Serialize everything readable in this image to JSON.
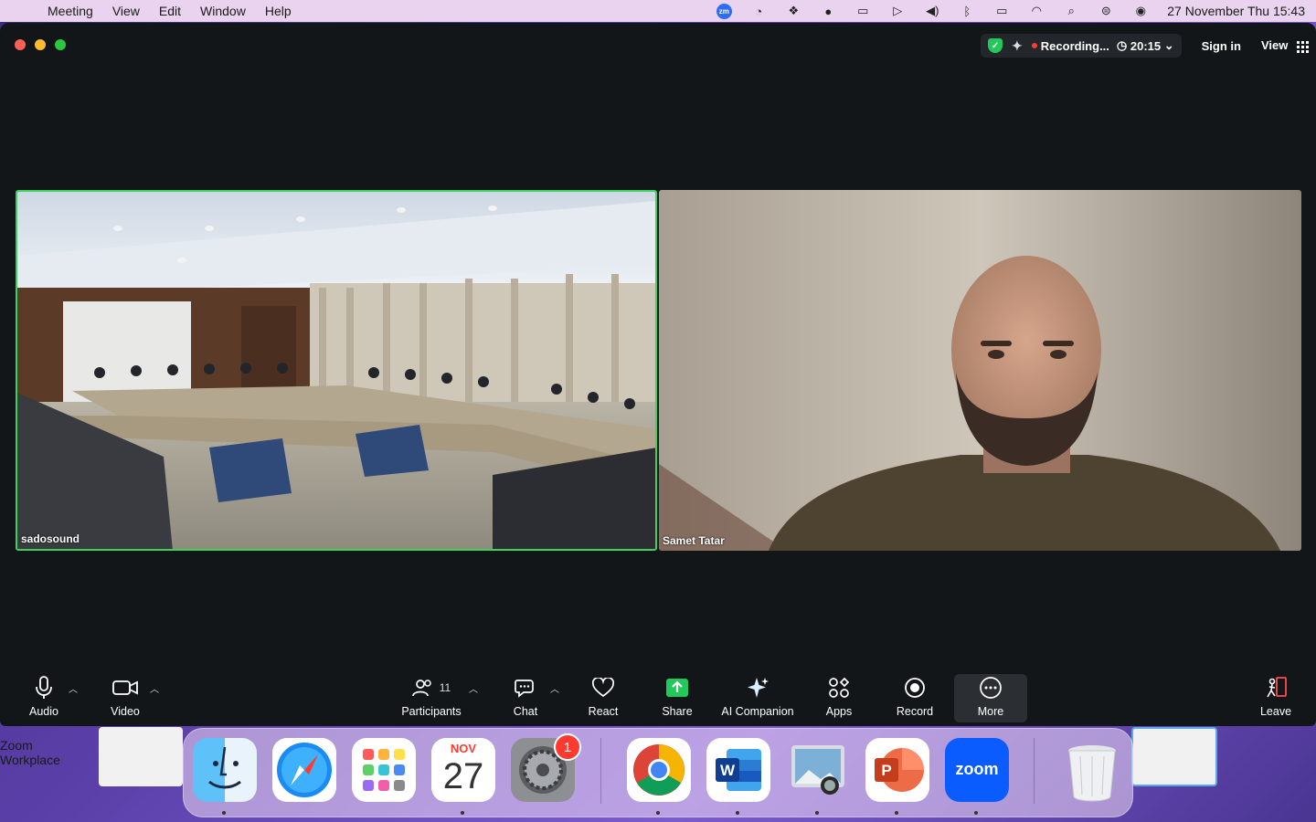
{
  "menubar": {
    "app_name": "Zoom Workplace",
    "items": [
      "Meeting",
      "View",
      "Edit",
      "Window",
      "Help"
    ],
    "status_icons": [
      "zoom-status-icon",
      "screen-time-icon",
      "dropbox-icon",
      "grammarly-icon",
      "screen-record-icon",
      "play-icon",
      "volume-icon",
      "bluetooth-icon",
      "battery-icon",
      "wifi-icon",
      "spotlight-icon",
      "control-center-icon",
      "siri-icon"
    ],
    "zoom_badge": "zm",
    "clock": "27 November Thu  15:43"
  },
  "window": {
    "recording_label": "Recording...",
    "timer": "20:15",
    "sign_in": "Sign in",
    "view": "View"
  },
  "tiles": [
    {
      "name": "sadosound",
      "active_speaker": true
    },
    {
      "name": "Samet Tatar",
      "active_speaker": false
    }
  ],
  "toolbar": {
    "audio": "Audio",
    "video": "Video",
    "participants": "Participants",
    "participants_count": "11",
    "chat": "Chat",
    "react": "React",
    "share": "Share",
    "ai_companion": "AI Companion",
    "apps": "Apps",
    "record": "Record",
    "more": "More",
    "leave": "Leave"
  },
  "dock": {
    "apps": [
      "Finder",
      "Safari",
      "Launchpad",
      "Calendar",
      "System Settings",
      "Google Chrome",
      "Microsoft Word",
      "Preview",
      "Microsoft PowerPoint",
      "Zoom",
      "Trash"
    ],
    "calendar_month": "NOV",
    "calendar_day": "27",
    "settings_badge": "1",
    "zoom_label": "zoom"
  },
  "colors": {
    "active_speaker_border": "#3ad35d",
    "share_green": "#23c85a",
    "recording_red": "#ff3b30",
    "window_bg": "#131619"
  }
}
